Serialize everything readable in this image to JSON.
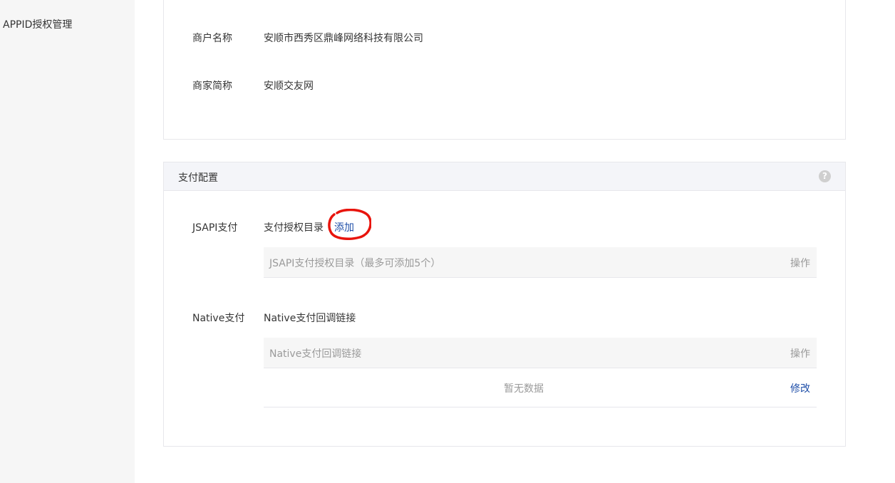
{
  "sidebar": {
    "items": [
      {
        "label": "APPID授权管理"
      }
    ]
  },
  "merchant": {
    "name_label": "商户名称",
    "name_value": "安顺市西秀区鼎峰网络科技有限公司",
    "short_label": "商家简称",
    "short_value": "安顺交友网"
  },
  "payment": {
    "title": "支付配置",
    "help_icon": "help-icon",
    "jsapi": {
      "label": "JSAPI支付",
      "dir_label": "支付授权目录",
      "add_label": "添加",
      "table_header": "JSAPI支付授权目录（最多可添加5个）",
      "table_action_header": "操作"
    },
    "native": {
      "label": "Native支付",
      "callback_label": "Native支付回调链接",
      "table_header": "Native支付回调链接",
      "table_action_header": "操作",
      "empty_text": "暂无数据",
      "edit_label": "修改"
    }
  },
  "colors": {
    "link": "#1e4ea8",
    "annotation": "#e8140c",
    "sidebar_bg": "#f6f6f6",
    "header_bg": "#f4f5f9"
  }
}
